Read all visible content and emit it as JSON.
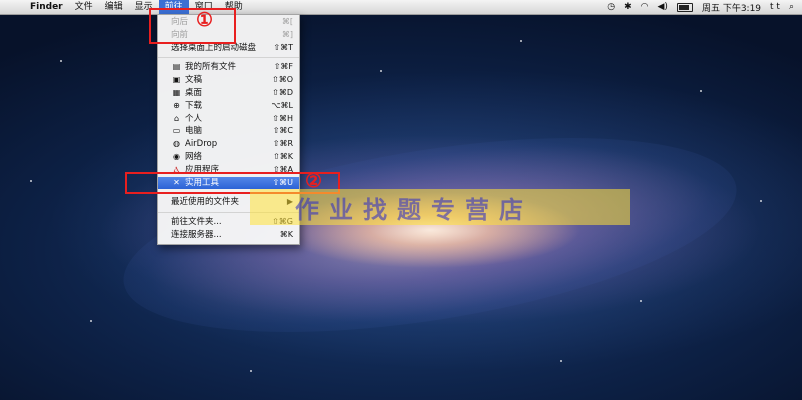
{
  "menubar": {
    "apple_icon": "",
    "app_name": "Finder",
    "menus": [
      "文件",
      "编辑",
      "显示",
      "前往",
      "窗口",
      "帮助"
    ],
    "active_menu": "前往",
    "clock": "周五 下午3:19",
    "user": "t t",
    "battery_level": 0.85,
    "status_icons": [
      "time-machine-icon",
      "bluetooth-icon",
      "wifi-icon",
      "volume-icon",
      "battery-icon",
      "search-icon"
    ]
  },
  "go_menu": {
    "items": [
      {
        "label": "向后",
        "shortcut": "⌘[",
        "disabled": true,
        "icon": ""
      },
      {
        "label": "向前",
        "shortcut": "⌘]",
        "disabled": true,
        "icon": ""
      },
      {
        "label": "选择桌面上的启动磁盘",
        "shortcut": "⇧⌘T",
        "icon": ""
      },
      {
        "label": "我的所有文件",
        "shortcut": "⇧⌘F",
        "icon": "▤"
      },
      {
        "label": "文稿",
        "shortcut": "⇧⌘O",
        "icon": "▣"
      },
      {
        "label": "桌面",
        "shortcut": "⇧⌘D",
        "icon": "▦"
      },
      {
        "label": "下载",
        "shortcut": "⌥⌘L",
        "icon": "⊕"
      },
      {
        "label": "个人",
        "shortcut": "⇧⌘H",
        "icon": "⌂"
      },
      {
        "label": "电脑",
        "shortcut": "⇧⌘C",
        "icon": "▭"
      },
      {
        "label": "AirDrop",
        "shortcut": "⇧⌘R",
        "icon": "◍"
      },
      {
        "label": "网络",
        "shortcut": "⇧⌘K",
        "icon": "◉"
      },
      {
        "label": "应用程序",
        "shortcut": "⇧⌘A",
        "icon": "Ⲁ"
      },
      {
        "label": "实用工具",
        "shortcut": "⇧⌘U",
        "icon": "✕",
        "highlighted": true
      },
      {
        "label": "最近使用的文件夹",
        "shortcut": "▶",
        "icon": ""
      },
      {
        "label": "前往文件夹...",
        "shortcut": "⇧⌘G",
        "icon": ""
      },
      {
        "label": "连接服务器...",
        "shortcut": "⌘K",
        "icon": ""
      }
    ]
  },
  "annotations": {
    "one": "①",
    "two": "②"
  },
  "watermark": "作业找题专营店",
  "colors": {
    "menu_highlight": "#3b6fd4",
    "annotation_red": "#e81f1f",
    "watermark_bg": "#ffe137"
  }
}
